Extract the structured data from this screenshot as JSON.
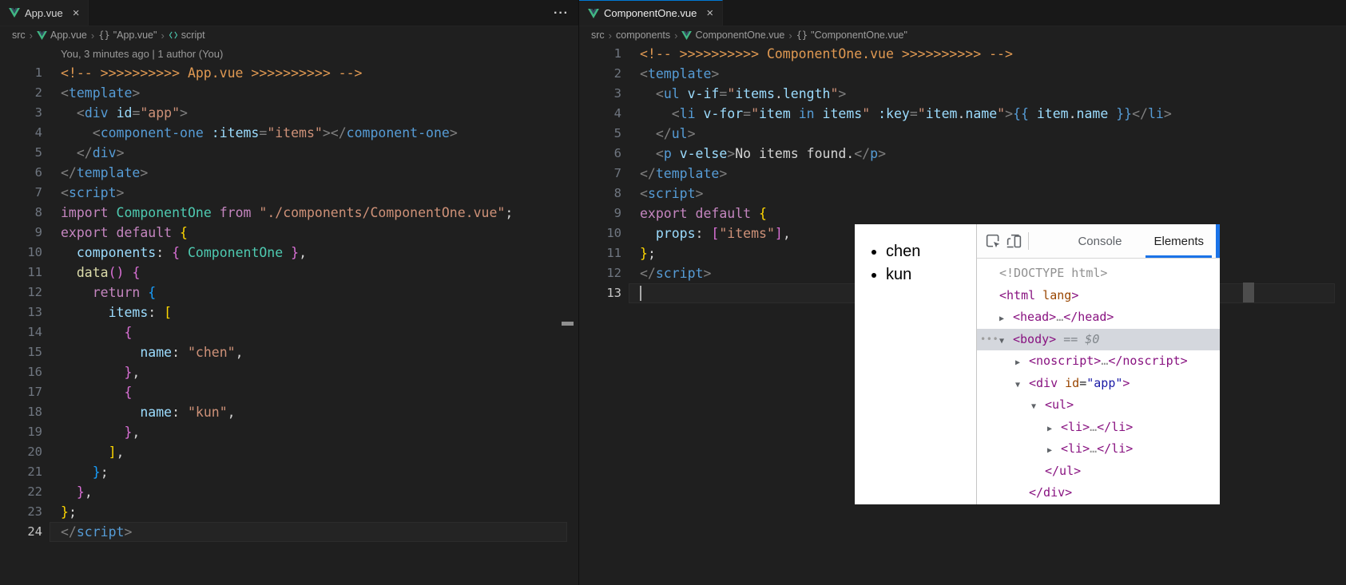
{
  "colors": {
    "editor_bg": "#1f1f1f",
    "tabstrip_bg": "#181818",
    "focused_tab_accent": "#0078d4",
    "devtools_accent": "#1a73e8",
    "devtools_selection_bg": "#d4d7dd",
    "vue_green": "#41b883",
    "vue_navy": "#35495e"
  },
  "icons": {
    "close": "×",
    "more": "···",
    "crumb_sep": "›",
    "expand": "▶",
    "collapse": "▼"
  },
  "palette": {
    "pun": "#808080",
    "tag": "#569cd6",
    "attr": "#9cdcfe",
    "str": "#ce9178",
    "kw": "#c586c0",
    "cls": "#4ec9b0",
    "fn": "#dcdcaa",
    "txt": "#d4d4d4",
    "cm": "#e09952",
    "b1": "#ffd700",
    "b2": "#da70d6",
    "b3": "#179fff",
    "kw2": "#569cd6"
  },
  "devtools_palette": {
    "tag": "#881280",
    "attr": "#994500",
    "val": "#1a1aa6",
    "muted": "#909090",
    "text": "#202124",
    "eq": "#80868b"
  },
  "left": {
    "tab": "App.vue",
    "codelens": "You, 3 minutes ago | 1 author (You)",
    "active_line": 24,
    "breadcrumb": [
      {
        "label": "src"
      },
      {
        "label": "App.vue",
        "icon": "vue-icon"
      },
      {
        "label": "\"App.vue\"",
        "icon": "braces-icon"
      },
      {
        "label": "script",
        "icon": "symbol-icon"
      }
    ],
    "lines": [
      {
        "n": 1,
        "t": [
          [
            "cm",
            "<!-- >>>>>>>>>> App.vue >>>>>>>>>> -->"
          ]
        ]
      },
      {
        "n": 2,
        "t": [
          [
            "pun",
            "<"
          ],
          [
            "tag",
            "template"
          ],
          [
            "pun",
            ">"
          ]
        ]
      },
      {
        "n": 3,
        "t": [
          [
            "txt",
            "  "
          ],
          [
            "pun",
            "<"
          ],
          [
            "tag",
            "div"
          ],
          [
            "txt",
            " "
          ],
          [
            "attr",
            "id"
          ],
          [
            "pun",
            "="
          ],
          [
            "str",
            "\"app\""
          ],
          [
            "pun",
            ">"
          ]
        ]
      },
      {
        "n": 4,
        "t": [
          [
            "txt",
            "    "
          ],
          [
            "pun",
            "<"
          ],
          [
            "tag",
            "component-one"
          ],
          [
            "txt",
            " "
          ],
          [
            "attr",
            ":items"
          ],
          [
            "pun",
            "="
          ],
          [
            "str",
            "\"items\""
          ],
          [
            "pun",
            "></"
          ],
          [
            "tag",
            "component-one"
          ],
          [
            "pun",
            ">"
          ]
        ]
      },
      {
        "n": 5,
        "t": [
          [
            "txt",
            "  "
          ],
          [
            "pun",
            "</"
          ],
          [
            "tag",
            "div"
          ],
          [
            "pun",
            ">"
          ]
        ]
      },
      {
        "n": 6,
        "t": [
          [
            "pun",
            "</"
          ],
          [
            "tag",
            "template"
          ],
          [
            "pun",
            ">"
          ]
        ]
      },
      {
        "n": 7,
        "t": [
          [
            "pun",
            "<"
          ],
          [
            "tag",
            "script"
          ],
          [
            "pun",
            ">"
          ]
        ]
      },
      {
        "n": 8,
        "t": [
          [
            "kw",
            "import"
          ],
          [
            "txt",
            " "
          ],
          [
            "cls",
            "ComponentOne"
          ],
          [
            "txt",
            " "
          ],
          [
            "kw",
            "from"
          ],
          [
            "txt",
            " "
          ],
          [
            "str",
            "\"./components/ComponentOne.vue\""
          ],
          [
            "txt",
            ";"
          ]
        ]
      },
      {
        "n": 9,
        "t": [
          [
            "kw",
            "export"
          ],
          [
            "txt",
            " "
          ],
          [
            "kw",
            "default"
          ],
          [
            "txt",
            " "
          ],
          [
            "b1",
            "{"
          ]
        ]
      },
      {
        "n": 10,
        "t": [
          [
            "txt",
            "  "
          ],
          [
            "attr",
            "components"
          ],
          [
            "txt",
            ": "
          ],
          [
            "b2",
            "{"
          ],
          [
            "txt",
            " "
          ],
          [
            "cls",
            "ComponentOne"
          ],
          [
            "txt",
            " "
          ],
          [
            "b2",
            "}"
          ],
          [
            "txt",
            ","
          ]
        ]
      },
      {
        "n": 11,
        "t": [
          [
            "txt",
            "  "
          ],
          [
            "fn",
            "data"
          ],
          [
            "b2",
            "()"
          ],
          [
            "txt",
            " "
          ],
          [
            "b2",
            "{"
          ]
        ]
      },
      {
        "n": 12,
        "t": [
          [
            "txt",
            "    "
          ],
          [
            "kw",
            "return"
          ],
          [
            "txt",
            " "
          ],
          [
            "b3",
            "{"
          ]
        ]
      },
      {
        "n": 13,
        "t": [
          [
            "txt",
            "      "
          ],
          [
            "attr",
            "items"
          ],
          [
            "txt",
            ": "
          ],
          [
            "b1",
            "["
          ]
        ]
      },
      {
        "n": 14,
        "t": [
          [
            "txt",
            "        "
          ],
          [
            "b2",
            "{"
          ]
        ]
      },
      {
        "n": 15,
        "t": [
          [
            "txt",
            "          "
          ],
          [
            "attr",
            "name"
          ],
          [
            "txt",
            ": "
          ],
          [
            "str",
            "\"chen\""
          ],
          [
            "txt",
            ","
          ]
        ]
      },
      {
        "n": 16,
        "t": [
          [
            "txt",
            "        "
          ],
          [
            "b2",
            "}"
          ],
          [
            "txt",
            ","
          ]
        ]
      },
      {
        "n": 17,
        "t": [
          [
            "txt",
            "        "
          ],
          [
            "b2",
            "{"
          ]
        ]
      },
      {
        "n": 18,
        "t": [
          [
            "txt",
            "          "
          ],
          [
            "attr",
            "name"
          ],
          [
            "txt",
            ": "
          ],
          [
            "str",
            "\"kun\""
          ],
          [
            "txt",
            ","
          ]
        ]
      },
      {
        "n": 19,
        "t": [
          [
            "txt",
            "        "
          ],
          [
            "b2",
            "}"
          ],
          [
            "txt",
            ","
          ]
        ]
      },
      {
        "n": 20,
        "t": [
          [
            "txt",
            "      "
          ],
          [
            "b1",
            "]"
          ],
          [
            "txt",
            ","
          ]
        ]
      },
      {
        "n": 21,
        "t": [
          [
            "txt",
            "    "
          ],
          [
            "b3",
            "}"
          ],
          [
            "txt",
            ";"
          ]
        ]
      },
      {
        "n": 22,
        "t": [
          [
            "txt",
            "  "
          ],
          [
            "b2",
            "}"
          ],
          [
            "txt",
            ","
          ]
        ]
      },
      {
        "n": 23,
        "t": [
          [
            "b1",
            "}"
          ],
          [
            "txt",
            ";"
          ]
        ]
      },
      {
        "n": 24,
        "t": [
          [
            "pun",
            "</"
          ],
          [
            "tag",
            "script"
          ],
          [
            "pun",
            ">"
          ]
        ]
      }
    ]
  },
  "right": {
    "tab": "ComponentOne.vue",
    "active_line": 13,
    "breadcrumb": [
      {
        "label": "src"
      },
      {
        "label": "components"
      },
      {
        "label": "ComponentOne.vue",
        "icon": "vue-icon"
      },
      {
        "label": "\"ComponentOne.vue\"",
        "icon": "braces-icon"
      }
    ],
    "lines": [
      {
        "n": 1,
        "t": [
          [
            "cm",
            "<!-- >>>>>>>>>> ComponentOne.vue >>>>>>>>>> -->"
          ]
        ]
      },
      {
        "n": 2,
        "t": [
          [
            "pun",
            "<"
          ],
          [
            "tag",
            "template"
          ],
          [
            "pun",
            ">"
          ]
        ]
      },
      {
        "n": 3,
        "t": [
          [
            "txt",
            "  "
          ],
          [
            "pun",
            "<"
          ],
          [
            "tag",
            "ul"
          ],
          [
            "txt",
            " "
          ],
          [
            "attr",
            "v-if"
          ],
          [
            "pun",
            "="
          ],
          [
            "str",
            "\""
          ],
          [
            "attr",
            "items"
          ],
          [
            "txt",
            "."
          ],
          [
            "attr",
            "length"
          ],
          [
            "str",
            "\""
          ],
          [
            "pun",
            ">"
          ]
        ]
      },
      {
        "n": 4,
        "t": [
          [
            "txt",
            "    "
          ],
          [
            "pun",
            "<"
          ],
          [
            "tag",
            "li"
          ],
          [
            "txt",
            " "
          ],
          [
            "attr",
            "v-for"
          ],
          [
            "pun",
            "="
          ],
          [
            "str",
            "\""
          ],
          [
            "attr",
            "item"
          ],
          [
            "txt",
            " "
          ],
          [
            "kw2",
            "in"
          ],
          [
            "txt",
            " "
          ],
          [
            "attr",
            "items"
          ],
          [
            "str",
            "\""
          ],
          [
            "txt",
            " "
          ],
          [
            "attr",
            ":key"
          ],
          [
            "pun",
            "="
          ],
          [
            "str",
            "\""
          ],
          [
            "attr",
            "item"
          ],
          [
            "txt",
            "."
          ],
          [
            "attr",
            "name"
          ],
          [
            "str",
            "\""
          ],
          [
            "pun",
            ">"
          ],
          [
            "kw2",
            "{{"
          ],
          [
            "txt",
            " "
          ],
          [
            "attr",
            "item"
          ],
          [
            "txt",
            "."
          ],
          [
            "attr",
            "name"
          ],
          [
            "txt",
            " "
          ],
          [
            "kw2",
            "}}"
          ],
          [
            "pun",
            "</"
          ],
          [
            "tag",
            "li"
          ],
          [
            "pun",
            ">"
          ]
        ]
      },
      {
        "n": 5,
        "t": [
          [
            "txt",
            "  "
          ],
          [
            "pun",
            "</"
          ],
          [
            "tag",
            "ul"
          ],
          [
            "pun",
            ">"
          ]
        ]
      },
      {
        "n": 6,
        "t": [
          [
            "txt",
            "  "
          ],
          [
            "pun",
            "<"
          ],
          [
            "tag",
            "p"
          ],
          [
            "txt",
            " "
          ],
          [
            "attr",
            "v-else"
          ],
          [
            "pun",
            ">"
          ],
          [
            "txt",
            "No items found."
          ],
          [
            "pun",
            "</"
          ],
          [
            "tag",
            "p"
          ],
          [
            "pun",
            ">"
          ]
        ]
      },
      {
        "n": 7,
        "t": [
          [
            "pun",
            "</"
          ],
          [
            "tag",
            "template"
          ],
          [
            "pun",
            ">"
          ]
        ]
      },
      {
        "n": 8,
        "t": [
          [
            "pun",
            "<"
          ],
          [
            "tag",
            "script"
          ],
          [
            "pun",
            ">"
          ]
        ]
      },
      {
        "n": 9,
        "t": [
          [
            "kw",
            "export"
          ],
          [
            "txt",
            " "
          ],
          [
            "kw",
            "default"
          ],
          [
            "txt",
            " "
          ],
          [
            "b1",
            "{"
          ]
        ]
      },
      {
        "n": 10,
        "t": [
          [
            "txt",
            "  "
          ],
          [
            "attr",
            "props"
          ],
          [
            "txt",
            ": "
          ],
          [
            "b2",
            "["
          ],
          [
            "str",
            "\"items\""
          ],
          [
            "b2",
            "]"
          ],
          [
            "txt",
            ","
          ]
        ]
      },
      {
        "n": 11,
        "t": [
          [
            "b1",
            "}"
          ],
          [
            "txt",
            ";"
          ]
        ]
      },
      {
        "n": 12,
        "t": [
          [
            "pun",
            "</"
          ],
          [
            "tag",
            "script"
          ],
          [
            "pun",
            ">"
          ]
        ]
      },
      {
        "n": 13,
        "t": [],
        "cursor": true
      }
    ]
  },
  "overlay": {
    "page_items": [
      "chen",
      "kun"
    ],
    "devtools": {
      "tabs": [
        {
          "label": "Console",
          "active": false
        },
        {
          "label": "Elements",
          "active": true
        }
      ],
      "tree": [
        {
          "i": 0,
          "a": "",
          "k": [
            [
              "muted",
              "<!DOCTYPE html>"
            ]
          ]
        },
        {
          "i": 0,
          "a": "",
          "k": [
            [
              "tag",
              "<html"
            ],
            [
              "attr",
              " lang"
            ],
            [
              "tag",
              ">"
            ]
          ]
        },
        {
          "i": 0,
          "a": "r",
          "k": [
            [
              "tag",
              "<head>"
            ],
            [
              "muted",
              "…"
            ],
            [
              "tag",
              "</head>"
            ]
          ]
        },
        {
          "i": 0,
          "a": "d",
          "sel": true,
          "dots": "•••",
          "k": [
            [
              "tag",
              "<body>"
            ],
            [
              "eq",
              " == $0"
            ]
          ]
        },
        {
          "i": 1,
          "a": "r",
          "k": [
            [
              "tag",
              "<noscript>"
            ],
            [
              "muted",
              "…"
            ],
            [
              "tag",
              "</noscript>"
            ]
          ]
        },
        {
          "i": 1,
          "a": "d",
          "k": [
            [
              "tag",
              "<div"
            ],
            [
              "attr",
              " id"
            ],
            [
              "text",
              "="
            ],
            [
              "val",
              "\"app\""
            ],
            [
              "tag",
              ">"
            ]
          ]
        },
        {
          "i": 2,
          "a": "d",
          "k": [
            [
              "tag",
              "<ul>"
            ]
          ]
        },
        {
          "i": 3,
          "a": "r",
          "k": [
            [
              "tag",
              "<li>"
            ],
            [
              "muted",
              "…"
            ],
            [
              "tag",
              "</li>"
            ]
          ]
        },
        {
          "i": 3,
          "a": "r",
          "k": [
            [
              "tag",
              "<li>"
            ],
            [
              "muted",
              "…"
            ],
            [
              "tag",
              "</li>"
            ]
          ]
        },
        {
          "i": 2,
          "a": "",
          "close": true,
          "k": [
            [
              "tag",
              "</ul>"
            ]
          ]
        },
        {
          "i": 1,
          "a": "",
          "close": true,
          "k": [
            [
              "tag",
              "</div>"
            ]
          ]
        }
      ]
    }
  }
}
